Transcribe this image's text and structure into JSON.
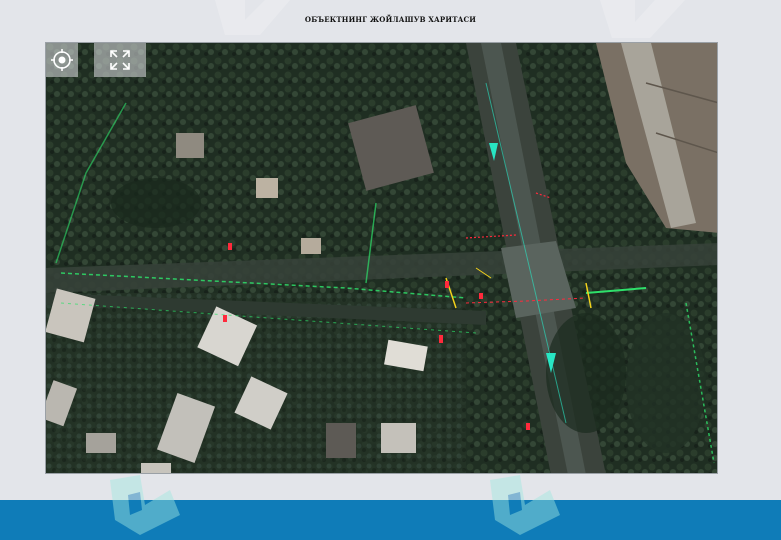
{
  "page": {
    "title": "ОБЪЕКТНИНГ ЖОЙЛАШУВ ХАРИТАСИ"
  },
  "map": {
    "view": "satellite",
    "controls": [
      {
        "name": "locate",
        "icon": "locate-target-icon"
      },
      {
        "name": "fullscreen",
        "icon": "fullscreen-expand-icon"
      }
    ]
  },
  "colors": {
    "background": "#e3e5ea",
    "footer": "#0f7cb8",
    "watermark": "#9fe8e0",
    "overlay_green": "#2ee06a",
    "overlay_red": "#ff2a3c",
    "overlay_yellow": "#f3d21c",
    "overlay_cyan": "#28e6c4"
  }
}
